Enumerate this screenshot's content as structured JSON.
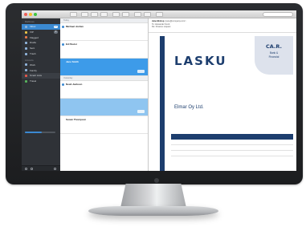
{
  "colors": {
    "accent": "#3b89d1",
    "sidebar": "#2f3237",
    "invoice_navy": "#1d3e6e",
    "selected_row": "#3d9be9"
  },
  "toolbar": {
    "buttons": [
      "reply-icon",
      "reply-all-icon",
      "forward-icon",
      "archive-icon",
      "trash-icon",
      "flag-icon",
      "move-icon",
      "compose-icon"
    ],
    "search_placeholder": ""
  },
  "sidebar": {
    "section_label": "Mailboxes",
    "items": [
      {
        "label": "Inbox",
        "count": "12",
        "active": true
      },
      {
        "label": "VIP",
        "count": "4",
        "active": false
      },
      {
        "label": "Flagged",
        "count": "",
        "active": false
      },
      {
        "label": "Drafts",
        "count": "",
        "active": false
      },
      {
        "label": "Sent",
        "count": "",
        "active": false
      },
      {
        "label": "Trash",
        "count": "",
        "active": false
      }
    ],
    "section_label_2": "Accounts",
    "items_2": [
      {
        "label": "Work",
        "count": "",
        "active": false
      },
      {
        "label": "Family",
        "count": "",
        "active": false
      },
      {
        "label": "Smart Lists",
        "count": "",
        "active": false
      },
      {
        "label": "Travel",
        "count": "",
        "active": false
      }
    ],
    "storage_label": "",
    "storage_fraction": 0.55
  },
  "message_list": {
    "group_1": "Today",
    "messages": [
      {
        "from": "Michael Jordan",
        "date": "",
        "subject": "",
        "preview": "",
        "unread": true,
        "selected": false,
        "attachment": false
      },
      {
        "from": "Ed Pastor",
        "date": "",
        "subject": "",
        "preview": "",
        "unread": true,
        "selected": false,
        "attachment": false
      },
      {
        "from": "Jane Smith",
        "date": "",
        "subject": "",
        "preview": "",
        "unread": false,
        "selected": true,
        "attachment": true
      }
    ],
    "group_2": "Yesterday",
    "messages_2": [
      {
        "from": "Noah Jackson",
        "date": "",
        "subject": "",
        "preview": "",
        "unread": true,
        "selected": false,
        "attachment": false
      },
      {
        "from": "",
        "date": "",
        "subject": "",
        "preview": "",
        "unread": false,
        "selected": true,
        "attachment": true
      },
      {
        "from": "Susan Thompson",
        "date": "",
        "subject": "",
        "preview": "",
        "unread": false,
        "selected": false,
        "attachment": false
      }
    ]
  },
  "reader": {
    "from_line": "Jane Bishop",
    "from_email": "<jane@company.com>",
    "to_line": "To: Alexander Scott",
    "subject_line": "Re: Finance request",
    "date": "",
    "attachment_link": ""
  },
  "invoice": {
    "title": "LASKU",
    "logo_line_1": "CA.R.",
    "logo_line_2": "Bank &",
    "logo_line_3": "Financial",
    "meta": [
      "",
      "",
      ""
    ],
    "company": "Elmar Oy Ltd.",
    "address": [
      "",
      ""
    ],
    "details": [
      "",
      "",
      "",
      ""
    ],
    "table": {
      "headers": [
        "",
        "",
        "",
        ""
      ],
      "rows": [
        [
          "",
          "",
          ""
        ],
        [
          "",
          "",
          ""
        ],
        [
          "",
          "",
          ""
        ]
      ]
    }
  }
}
